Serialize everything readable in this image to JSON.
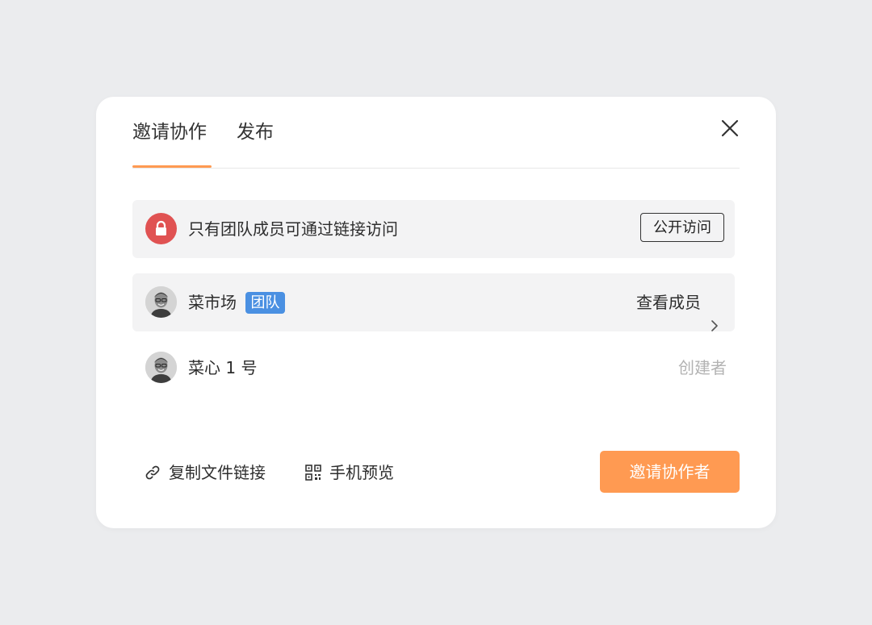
{
  "dialog": {
    "tabs": [
      {
        "label": "邀请协作"
      },
      {
        "label": "发布"
      }
    ],
    "close_icon": "close-icon"
  },
  "access": {
    "text": "只有团队成员可通过链接访问",
    "button": "公开访问",
    "icon": "lock-icon",
    "icon_color": "#e05252"
  },
  "team": {
    "name": "菜市场",
    "badge": "团队",
    "badge_color": "#4a90e2",
    "view_members": "查看成员"
  },
  "member": {
    "name": "菜心 1 号",
    "role": "创建者"
  },
  "footer": {
    "copy_link": "复制文件链接",
    "mobile_preview": "手机预览",
    "invite_button": "邀请协作者"
  },
  "colors": {
    "accent": "#ff9a52",
    "background": "#ebecee"
  }
}
